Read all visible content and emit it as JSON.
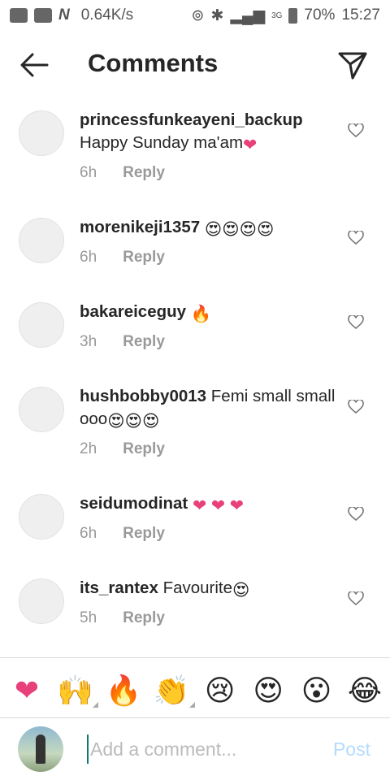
{
  "status_bar": {
    "net_speed": "0.64K/s",
    "network": "3G",
    "battery": "70%",
    "time": "15:27"
  },
  "header": {
    "title": "Comments"
  },
  "comments": [
    {
      "username": "princessfunkeayeni_backup",
      "text": "Happy Sunday ma'am",
      "emoji": "❤",
      "age": "6h",
      "reply": "Reply"
    },
    {
      "username": "morenikeji1357",
      "text": "",
      "emoji": "😍😍😍😍",
      "age": "6h",
      "reply": "Reply"
    },
    {
      "username": "bakareiceguy",
      "text": "",
      "emoji": "🔥",
      "age": "3h",
      "reply": "Reply"
    },
    {
      "username": "hushbobby0013",
      "text": "Femi small small ooo",
      "emoji": "😍😍😍",
      "age": "2h",
      "reply": "Reply"
    },
    {
      "username": "seidumodinat",
      "text": "",
      "emoji": "❤ ❤ ❤",
      "age": "6h",
      "reply": "Reply"
    },
    {
      "username": "its_rantex",
      "text": "Favourite",
      "emoji": "😍",
      "age": "5h",
      "reply": "Reply"
    }
  ],
  "reactions": [
    "❤",
    "🙌",
    "🔥",
    "👏",
    "😢",
    "😍",
    "😮",
    "😂"
  ],
  "composer": {
    "placeholder": "Add a comment...",
    "post_label": "Post"
  }
}
